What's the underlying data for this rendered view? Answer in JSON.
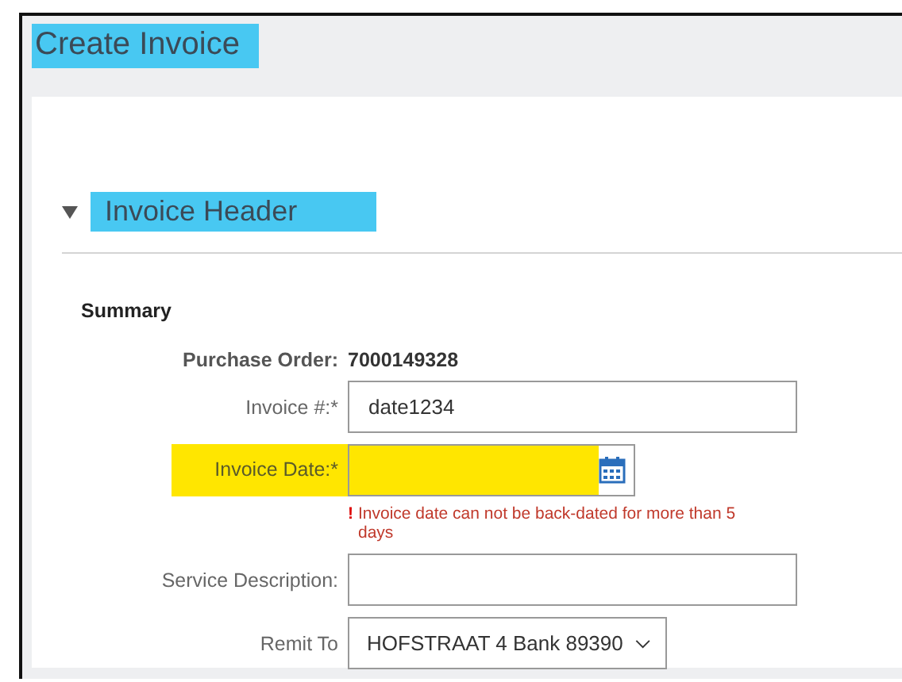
{
  "title": {
    "text": "Create Invoice",
    "highlighted": true
  },
  "section": {
    "title": "Invoice Header",
    "expanded": true,
    "highlighted": true
  },
  "subsection": "Summary",
  "rows": [
    {
      "kind": "readonly",
      "label": "Purchase Order:",
      "value": "7000149328",
      "highlighted": false
    },
    {
      "kind": "text",
      "label": "Invoice #:*",
      "value": "date1234",
      "highlighted": false
    },
    {
      "kind": "date",
      "label": "Invoice Date:*",
      "value": "",
      "highlighted": true,
      "error_mark": "!",
      "error": "Invoice date can not be back-dated for more than 5 days"
    },
    {
      "kind": "text",
      "label": "Service Description:",
      "value": "",
      "highlighted": false
    },
    {
      "kind": "select",
      "label": "Remit To",
      "value": "HOFSTRAAT 4 Bank 89390",
      "highlighted": false
    }
  ]
}
